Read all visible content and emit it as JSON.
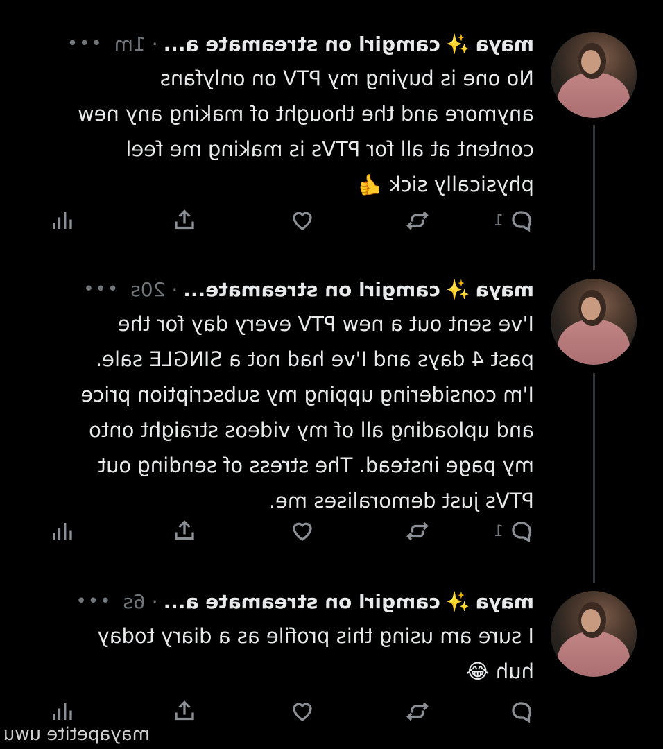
{
  "tweets": [
    {
      "name": "maya",
      "sparkle": "✨",
      "handle": "camgirl on streamate a...",
      "time": "· 1m",
      "more": "•••",
      "text": "No one is buying my PTV on onlyfans\nanymore and the thought of making any new\ncontent at all for PTVs is making me feel\nphysically sick 👍",
      "reply_count": "1"
    },
    {
      "name": "maya",
      "sparkle": "✨",
      "handle": "camgirl on streamate...",
      "time": "· 20s",
      "more": "•••",
      "text": "I've sent out a new PTV every day for the\npast 4 days and I've had not a SINGLE sale.\nI'm considering upping my subscription price\nand uploading all of my videos straight onto\nmy page instead. The stress of sending out\nPTVs just demoralises me.",
      "reply_count": "1"
    },
    {
      "name": "maya",
      "sparkle": "✨",
      "handle": "camgirl on streamate a...",
      "time": "· 6s",
      "more": "•••",
      "text": "I sure am using this profile as a diary today\nhuh 😂",
      "reply_count": ""
    }
  ],
  "icons": {
    "reply": "reply-icon",
    "retweet": "retweet-icon",
    "like": "heart-icon",
    "share": "share-icon",
    "views": "views-icon"
  },
  "watermark": "mayapetite uwu",
  "colors": {
    "background": "#000000",
    "text": "#e7e9ea",
    "muted": "#71767b"
  }
}
